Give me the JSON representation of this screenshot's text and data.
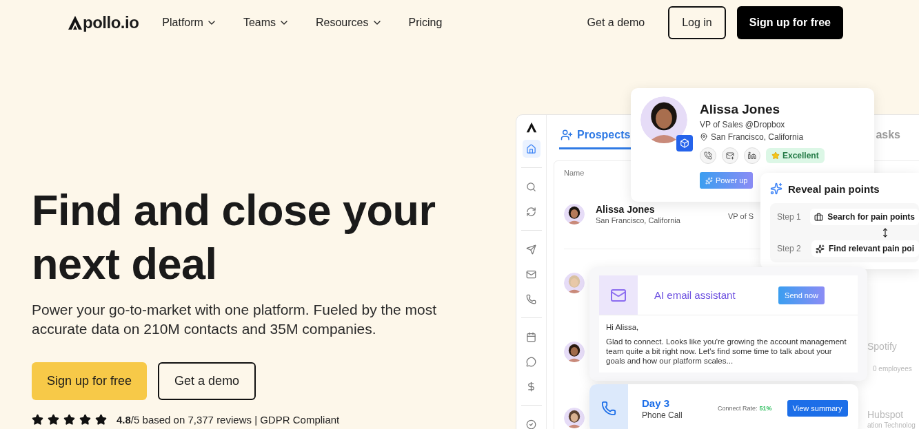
{
  "nav": {
    "logo": "pollo.io",
    "links": [
      {
        "label": "Platform",
        "has_menu": true
      },
      {
        "label": "Teams",
        "has_menu": true
      },
      {
        "label": "Resources",
        "has_menu": true
      },
      {
        "label": "Pricing",
        "has_menu": false
      }
    ],
    "actions": [
      {
        "label": "Get a demo",
        "kind": "text"
      },
      {
        "label": "Log in",
        "kind": "outline"
      },
      {
        "label": "Sign up for free",
        "kind": "solid"
      }
    ]
  },
  "hero": {
    "title": "Find and close your next deal",
    "subtitle": "Power your go-to-market with one platform. Fueled by the most accurate data on 210M contacts and 35M companies.",
    "buttons": [
      {
        "label": "Sign up for free",
        "kind": "primary"
      },
      {
        "label": "Get a demo",
        "kind": "outline"
      }
    ],
    "rating": {
      "stars": 5,
      "text": "**4.8**/5 based on 7,377 reviews | GDPR Compliant"
    }
  },
  "mockup": {
    "app": {
      "tabs": [
        {
          "label": "Prospects",
          "selected": true
        },
        {
          "label": "asks",
          "selected": false
        }
      ],
      "column": "Name",
      "row": {
        "name": "Alissa Jones",
        "location": "San Francisco, California",
        "title": "VP of S"
      },
      "faded": [
        {
          "text": "Spotify",
          "kind": "company"
        },
        {
          "text": "0 employees",
          "kind": "detail"
        },
        {
          "text": "Hubspot",
          "kind": "company"
        },
        {
          "text": "ation Technolog",
          "kind": "detail"
        }
      ]
    },
    "profile": {
      "name": "Alissa Jones",
      "title": "VP of Sales @Dropbox",
      "location": "San Francisco, California",
      "badge": "Excellent",
      "button": "Power up"
    },
    "pain": {
      "title": "Reveal pain points",
      "steps": [
        {
          "label": "Step 1",
          "text": "Search for pain points"
        },
        {
          "label": "Step 2",
          "text": "Find relevant pain poi"
        }
      ]
    },
    "email": {
      "title": "AI email assistant",
      "button": "Send now",
      "greeting": "Hi Alissa,",
      "body": "Glad to connect. Looks like you're growing the account management team quite a bit right now. Let's find some time to talk about your goals and how our platform scales..."
    },
    "call": {
      "day": "Day 3",
      "type": "Phone Call",
      "rate_label": "Connect Rate:",
      "rate": "51%",
      "button": "View summary"
    }
  }
}
